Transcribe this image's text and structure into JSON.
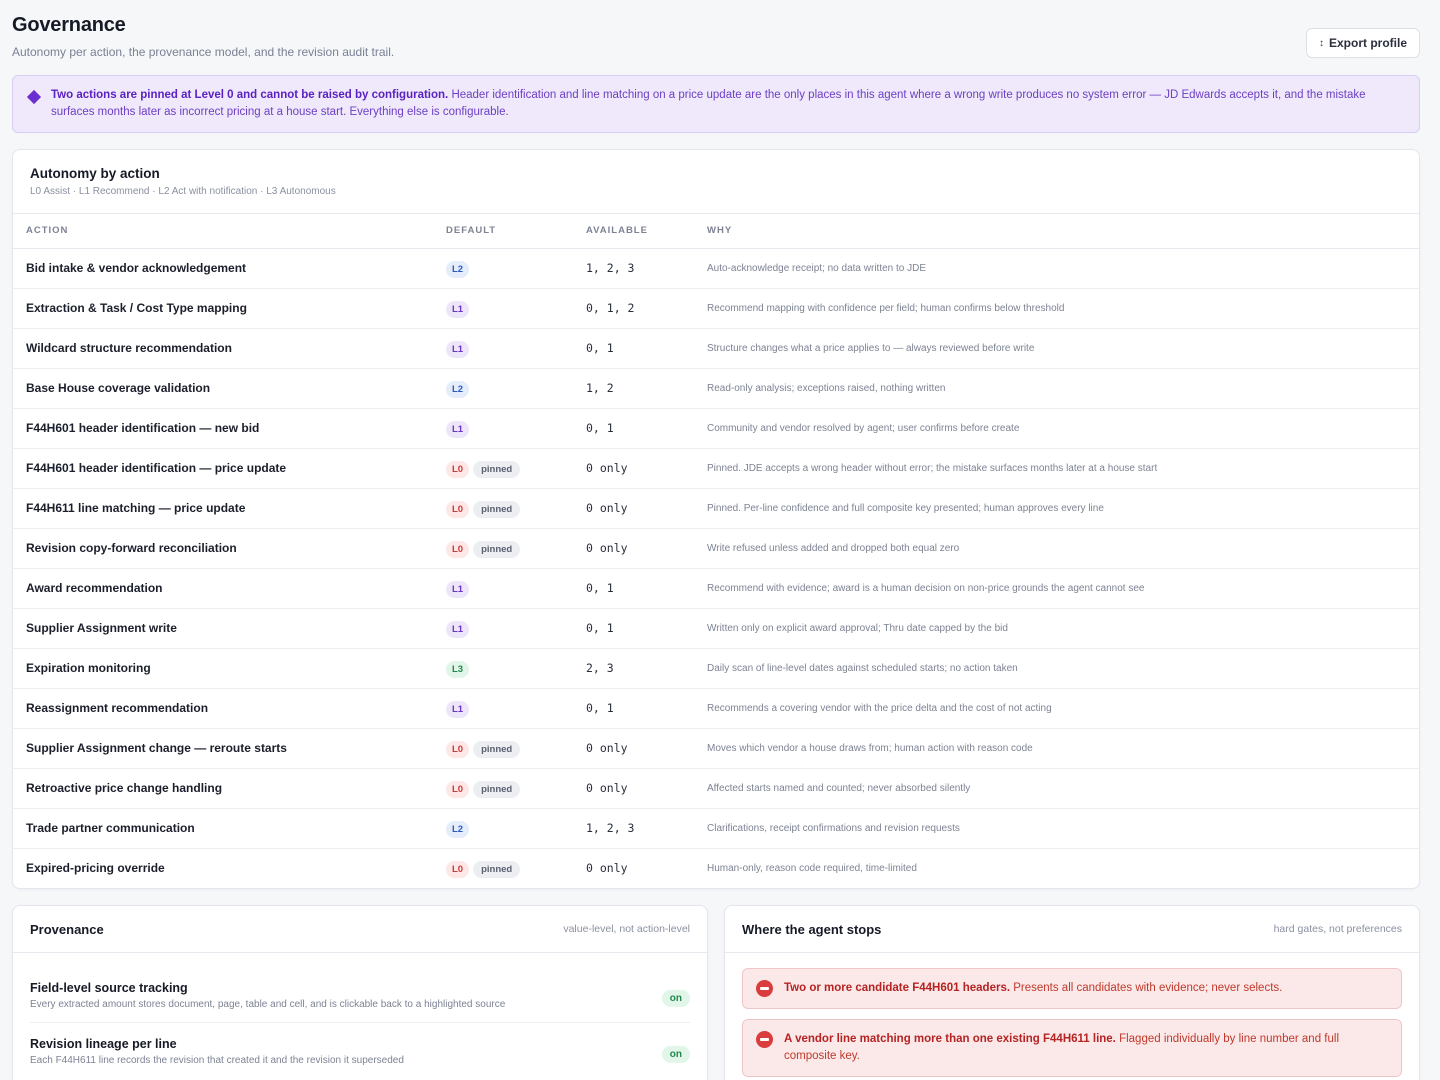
{
  "header": {
    "title": "Governance",
    "subtitle": "Autonomy per action, the provenance model, and the revision audit trail.",
    "export_label": "Export profile",
    "export_icon": "arrow-updown-icon"
  },
  "callout": {
    "bold": "Two actions are pinned at Level 0 and cannot be raised by configuration.",
    "text": " Header identification and line matching on a price update are the only places in this agent where a wrong write produces no system error — JD Edwards accepts it, and the mistake surfaces months later as incorrect pricing at a house start. Everything else is configurable.",
    "color": "#6b2fd1"
  },
  "autonomy": {
    "title": "Autonomy by action",
    "subtitle": "L0 Assist · L1 Recommend · L2 Act with notification · L3 Autonomous",
    "columns": [
      "ACTION",
      "DEFAULT",
      "AVAILABLE",
      "WHY"
    ],
    "pinned_label": "pinned",
    "rows": [
      {
        "action": "Bid intake & vendor acknowledgement",
        "level": "L2",
        "pinned": false,
        "available": "1, 2, 3",
        "why": "Auto-acknowledge receipt; no data written to JDE"
      },
      {
        "action": "Extraction & Task / Cost Type mapping",
        "level": "L1",
        "pinned": false,
        "available": "0, 1, 2",
        "why": "Recommend mapping with confidence per field; human confirms below threshold"
      },
      {
        "action": "Wildcard structure recommendation",
        "level": "L1",
        "pinned": false,
        "available": "0, 1",
        "why": "Structure changes what a price applies to — always reviewed before write"
      },
      {
        "action": "Base House coverage validation",
        "level": "L2",
        "pinned": false,
        "available": "1, 2",
        "why": "Read-only analysis; exceptions raised, nothing written"
      },
      {
        "action": "F44H601 header identification — new bid",
        "level": "L1",
        "pinned": false,
        "available": "0, 1",
        "why": "Community and vendor resolved by agent; user confirms before create"
      },
      {
        "action": "F44H601 header identification — price update",
        "level": "L0",
        "pinned": true,
        "available": "0 only",
        "why": "Pinned. JDE accepts a wrong header without error; the mistake surfaces months later at a house start"
      },
      {
        "action": "F44H611 line matching — price update",
        "level": "L0",
        "pinned": true,
        "available": "0 only",
        "why": "Pinned. Per-line confidence and full composite key presented; human approves every line"
      },
      {
        "action": "Revision copy-forward reconciliation",
        "level": "L0",
        "pinned": true,
        "available": "0 only",
        "why": "Write refused unless added and dropped both equal zero"
      },
      {
        "action": "Award recommendation",
        "level": "L1",
        "pinned": false,
        "available": "0, 1",
        "why": "Recommend with evidence; award is a human decision on non-price grounds the agent cannot see"
      },
      {
        "action": "Supplier Assignment write",
        "level": "L1",
        "pinned": false,
        "available": "0, 1",
        "why": "Written only on explicit award approval; Thru date capped by the bid"
      },
      {
        "action": "Expiration monitoring",
        "level": "L3",
        "pinned": false,
        "available": "2, 3",
        "why": "Daily scan of line-level dates against scheduled starts; no action taken"
      },
      {
        "action": "Reassignment recommendation",
        "level": "L1",
        "pinned": false,
        "available": "0, 1",
        "why": "Recommends a covering vendor with the price delta and the cost of not acting"
      },
      {
        "action": "Supplier Assignment change — reroute starts",
        "level": "L0",
        "pinned": true,
        "available": "0 only",
        "why": "Moves which vendor a house draws from; human action with reason code"
      },
      {
        "action": "Retroactive price change handling",
        "level": "L0",
        "pinned": true,
        "available": "0 only",
        "why": "Affected starts named and counted; never absorbed silently"
      },
      {
        "action": "Trade partner communication",
        "level": "L2",
        "pinned": false,
        "available": "1, 2, 3",
        "why": "Clarifications, receipt confirmations and revision requests"
      },
      {
        "action": "Expired-pricing override",
        "level": "L0",
        "pinned": true,
        "available": "0 only",
        "why": "Human-only, reason code required, time-limited"
      }
    ]
  },
  "provenance": {
    "title": "Provenance",
    "note": "value-level, not action-level",
    "items": [
      {
        "title": "Field-level source tracking",
        "desc": "Every extracted amount stores document, page, table and cell, and is clickable back to a highlighted source",
        "state": "on"
      },
      {
        "title": "Revision lineage per line",
        "desc": "Each F44H611 line records the revision that created it and the revision it superseded",
        "state": "on"
      }
    ]
  },
  "stops": {
    "title": "Where the agent stops",
    "note": "hard gates, not preferences",
    "items": [
      {
        "bold": "Two or more candidate F44H601 headers.",
        "text": " Presents all candidates with evidence; never selects."
      },
      {
        "bold": "A vendor line matching more than one existing F44H611 line.",
        "text": " Flagged individually by line number and full composite key."
      }
    ]
  }
}
